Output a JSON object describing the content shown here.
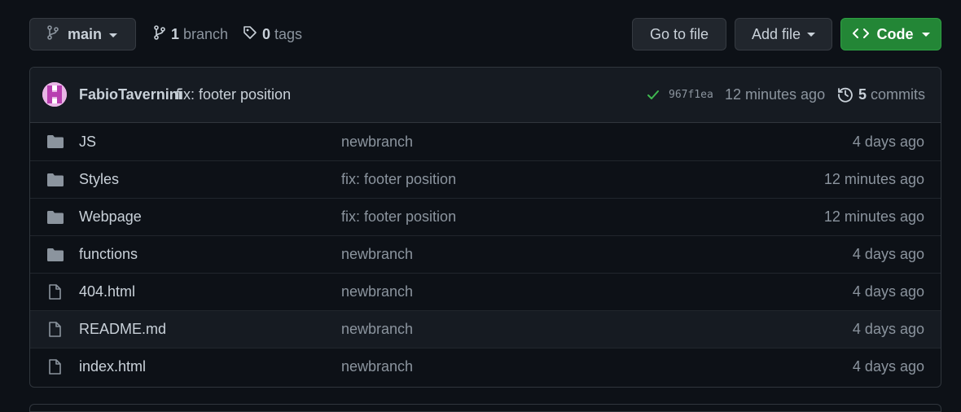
{
  "toolbar": {
    "branch_label": "main",
    "branch_count": "1",
    "branch_word": "branch",
    "tag_count": "0",
    "tag_word": "tags",
    "go_to_file_label": "Go to file",
    "add_file_label": "Add file",
    "code_label": "Code"
  },
  "commit": {
    "author": "FabioTavernini",
    "message": "fix: footer position",
    "sha": "967f1ea",
    "time": "12 minutes ago",
    "commit_count": "5",
    "commit_word": "commits",
    "status": "success"
  },
  "files": [
    {
      "name": "JS",
      "type": "folder",
      "message": "newbranch",
      "age": "4 days ago"
    },
    {
      "name": "Styles",
      "type": "folder",
      "message": "fix: footer position",
      "age": "12 minutes ago"
    },
    {
      "name": "Webpage",
      "type": "folder",
      "message": "fix: footer position",
      "age": "12 minutes ago"
    },
    {
      "name": "functions",
      "type": "folder",
      "message": "newbranch",
      "age": "4 days ago"
    },
    {
      "name": "404.html",
      "type": "file",
      "message": "newbranch",
      "age": "4 days ago"
    },
    {
      "name": "README.md",
      "type": "file",
      "message": "newbranch",
      "age": "4 days ago"
    },
    {
      "name": "index.html",
      "type": "file",
      "message": "newbranch",
      "age": "4 days ago"
    }
  ],
  "colors": {
    "background": "#0d1117",
    "border": "#30363d",
    "code_button": "#238636",
    "success": "#3fb950",
    "muted_text": "#8b949e"
  }
}
